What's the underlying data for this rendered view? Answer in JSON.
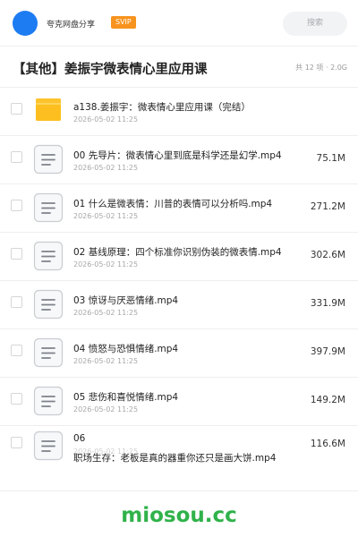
{
  "header": {
    "sharer_name": "夸克网盘分享",
    "vip_badge": "SVIP",
    "search_placeholder": "搜索"
  },
  "folder": {
    "title": "【其他】姜振宇微表情心里应用课",
    "summary": "共 12 项 · 2.0G"
  },
  "files": [
    {
      "type": "folder",
      "name": "a138.姜振宇：微表情心里应用课（完结）",
      "date": "2026-05-02 11:25",
      "size": ""
    },
    {
      "type": "file",
      "name": "00 先导片：微表情心里到底是科学还是幻学.mp4",
      "date": "2026-05-02 11:25",
      "size": "75.1M"
    },
    {
      "type": "file",
      "name": "01 什么是微表情：川普的表情可以分析吗.mp4",
      "date": "2026-05-02 11:25",
      "size": "271.2M"
    },
    {
      "type": "file",
      "name": "02 基线原理：四个标准你识别伪装的微表情.mp4",
      "date": "2026-05-02 11:25",
      "size": "302.6M"
    },
    {
      "type": "file",
      "name": "03 惊讶与厌恶情绪.mp4",
      "date": "2026-05-02 11:25",
      "size": "331.9M"
    },
    {
      "type": "file",
      "name": "04 愤怒与恐惧情绪.mp4",
      "date": "2026-05-02 11:25",
      "size": "397.9M"
    },
    {
      "type": "file",
      "name": "05 悲伤和喜悦情绪.mp4",
      "date": "2026-05-02 11:25",
      "size": "149.2M"
    },
    {
      "type": "file",
      "name": "06",
      "name_line2": "职场生存：老板是真的器重你还只是画大饼.mp4",
      "date": "2026-05-02 11:25",
      "size": "116.6M"
    }
  ],
  "watermark": "miosou.cc",
  "colors": {
    "brand_blue": "#1e7cf2",
    "vip_orange": "#f7931e",
    "folder_yellow": "#fcc32c",
    "watermark_green": "#2fb24a"
  }
}
